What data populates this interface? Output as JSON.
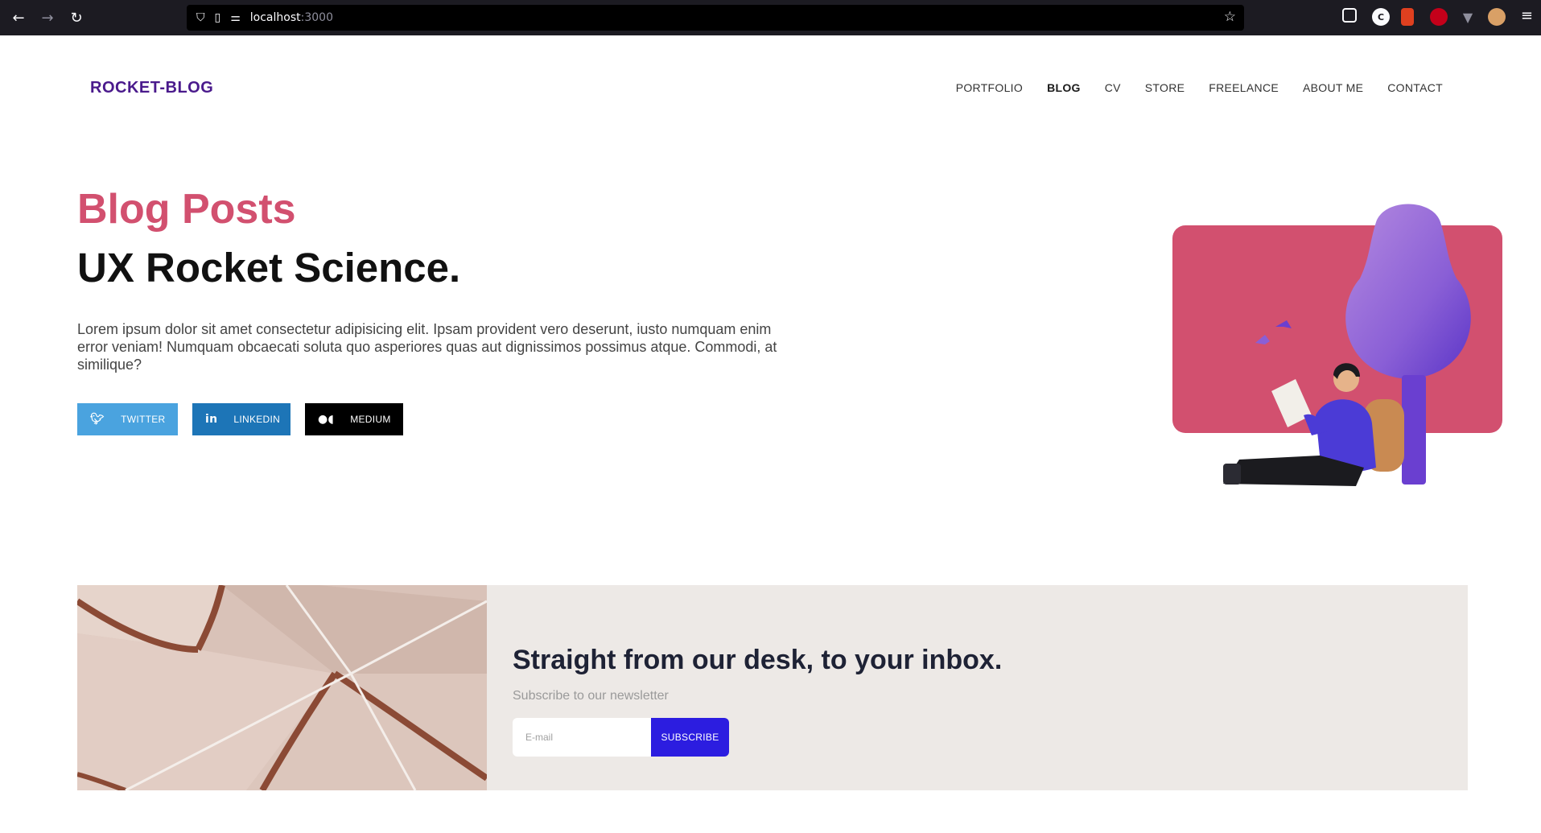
{
  "browser": {
    "url_host": "localhost",
    "url_port": ":3000",
    "extensions": [
      {
        "icon": "pocket-icon",
        "color": "#1c1b22"
      },
      {
        "icon": "c-extension-icon",
        "color": "#fbfbfe"
      },
      {
        "icon": "red-extension-icon",
        "color": "#e0401f"
      },
      {
        "icon": "ublock-icon",
        "color": "#c4001a"
      },
      {
        "icon": "v-extension-icon",
        "color": "#8f8f9d"
      },
      {
        "icon": "avatar-extension-icon",
        "color": "#d9a066"
      }
    ]
  },
  "site": {
    "brand": "ROCKET-BLOG",
    "nav": [
      "PORTFOLIO",
      "BLOG",
      "CV",
      "STORE",
      "FREELANCE",
      "ABOUT ME",
      "CONTACT"
    ],
    "active_nav": "BLOG"
  },
  "hero": {
    "title": "Blog Posts",
    "subtitle": "UX Rocket Science.",
    "text": "Lorem ipsum dolor sit amet consectetur adipisicing elit. Ipsam provident vero deserunt, iusto numquam enim error veniam! Numquam obcaecati soluta quo asperiores quas aut dignissimos possimus atque. Commodi, at similique?",
    "buttons": {
      "twitter": "TWITTER",
      "linkedin": "LINKEDIN",
      "medium": "MEDIUM"
    }
  },
  "newsletter": {
    "title": "Straight from our desk, to your inbox.",
    "subtitle": "Subscribe to our newsletter",
    "email_placeholder": "E-mail",
    "subscribe_label": "SUBSCRIBE"
  },
  "colors": {
    "brand": "#4a1a8c",
    "accent_pink": "#d2506f",
    "twitter": "#4aa3df",
    "linkedin": "#1d75b7",
    "medium": "#000000",
    "subscribe": "#2c1de0"
  }
}
